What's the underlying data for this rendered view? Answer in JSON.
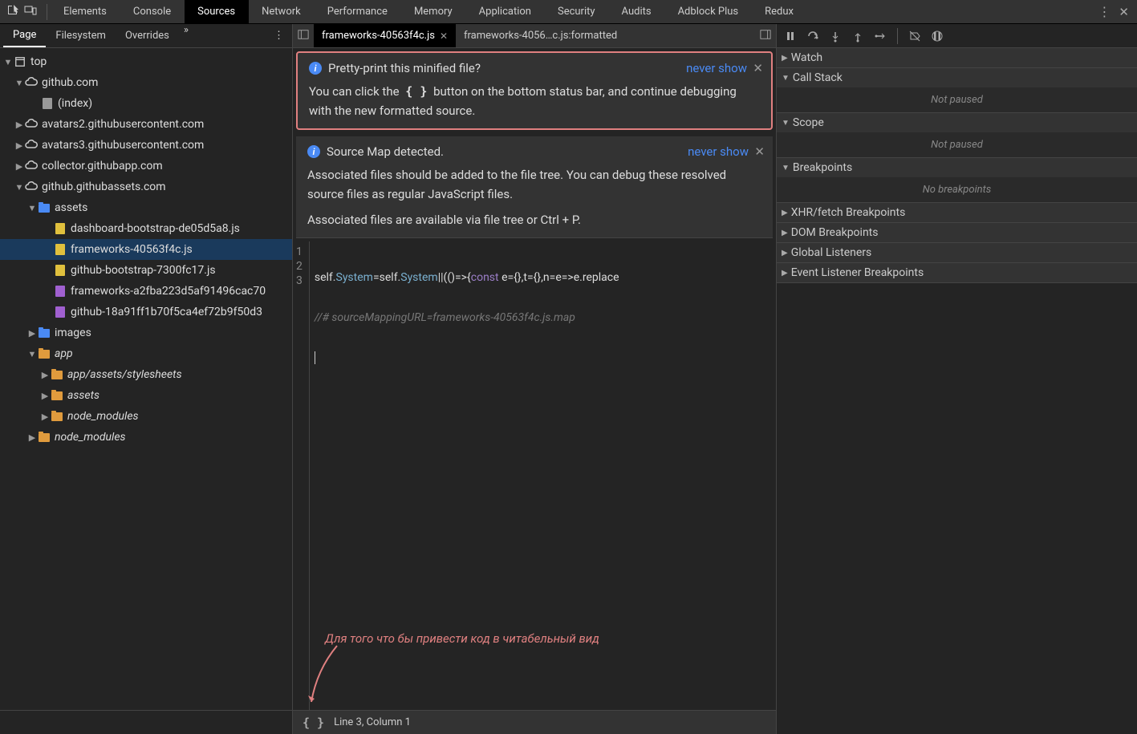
{
  "toolbar": {
    "tabs": [
      "Elements",
      "Console",
      "Sources",
      "Network",
      "Performance",
      "Memory",
      "Application",
      "Security",
      "Audits",
      "Adblock Plus",
      "Redux"
    ],
    "activeTab": "Sources"
  },
  "navigator": {
    "tabs": [
      "Page",
      "Filesystem",
      "Overrides"
    ],
    "activeTab": "Page",
    "tree": {
      "top": "top",
      "github": "github.com",
      "index": "(index)",
      "avatars2": "avatars2.githubusercontent.com",
      "avatars3": "avatars3.githubusercontent.com",
      "collector": "collector.githubapp.com",
      "githubassets": "github.githubassets.com",
      "assets": "assets",
      "dashboard": "dashboard-bootstrap-de05d5a8.js",
      "frameworks": "frameworks-40563f4c.js",
      "githubboot": "github-bootstrap-7300fc17.js",
      "fwlong": "frameworks-a2fba223d5af91496cac70",
      "ghlong": "github-18a91ff1b70f5ca4ef72b9f50d3",
      "images": "images",
      "app": "app",
      "appstyle": "app/assets/stylesheets",
      "assets2": "assets",
      "node1": "node_modules",
      "node2": "node_modules"
    }
  },
  "editor": {
    "tabs": [
      {
        "label": "frameworks-40563f4c.js",
        "active": true,
        "closable": true
      },
      {
        "label": "frameworks-4056…c.js:formatted",
        "active": false,
        "closable": false
      }
    ],
    "info1": {
      "title": "Pretty-print this minified file?",
      "body1": "You can click the",
      "braces": "{ }",
      "body2": "button on the bottom status bar, and continue debugging with the new formatted source.",
      "neverShow": "never show"
    },
    "info2": {
      "title": "Source Map detected.",
      "body1": "Associated files should be added to the file tree. You can debug these resolved source files as regular JavaScript files.",
      "body2": "Associated files are available via file tree or Ctrl + P.",
      "neverShow": "never show"
    },
    "code": {
      "line1_a": "self.",
      "line1_b": "System",
      "line1_c": "=self.",
      "line1_d": "System",
      "line1_e": "||((",
      "line1_f": ")=>{",
      "line1_g": "const ",
      "line1_h": "e={},t={},n=e=>e.replace",
      "line2": "//# sourceMappingURL=frameworks-40563f4c.js.map",
      "line3": ""
    },
    "lineNumbers": [
      "1",
      "2",
      "3"
    ],
    "annotation": "Для того что бы привести код в читабельный вид",
    "status": "Line 3, Column 1"
  },
  "debugger": {
    "sections": {
      "watch": "Watch",
      "callstack": "Call Stack",
      "callstack_body": "Not paused",
      "scope": "Scope",
      "scope_body": "Not paused",
      "breakpoints": "Breakpoints",
      "breakpoints_body": "No breakpoints",
      "xhr": "XHR/fetch Breakpoints",
      "dom": "DOM Breakpoints",
      "global": "Global Listeners",
      "event": "Event Listener Breakpoints"
    }
  }
}
